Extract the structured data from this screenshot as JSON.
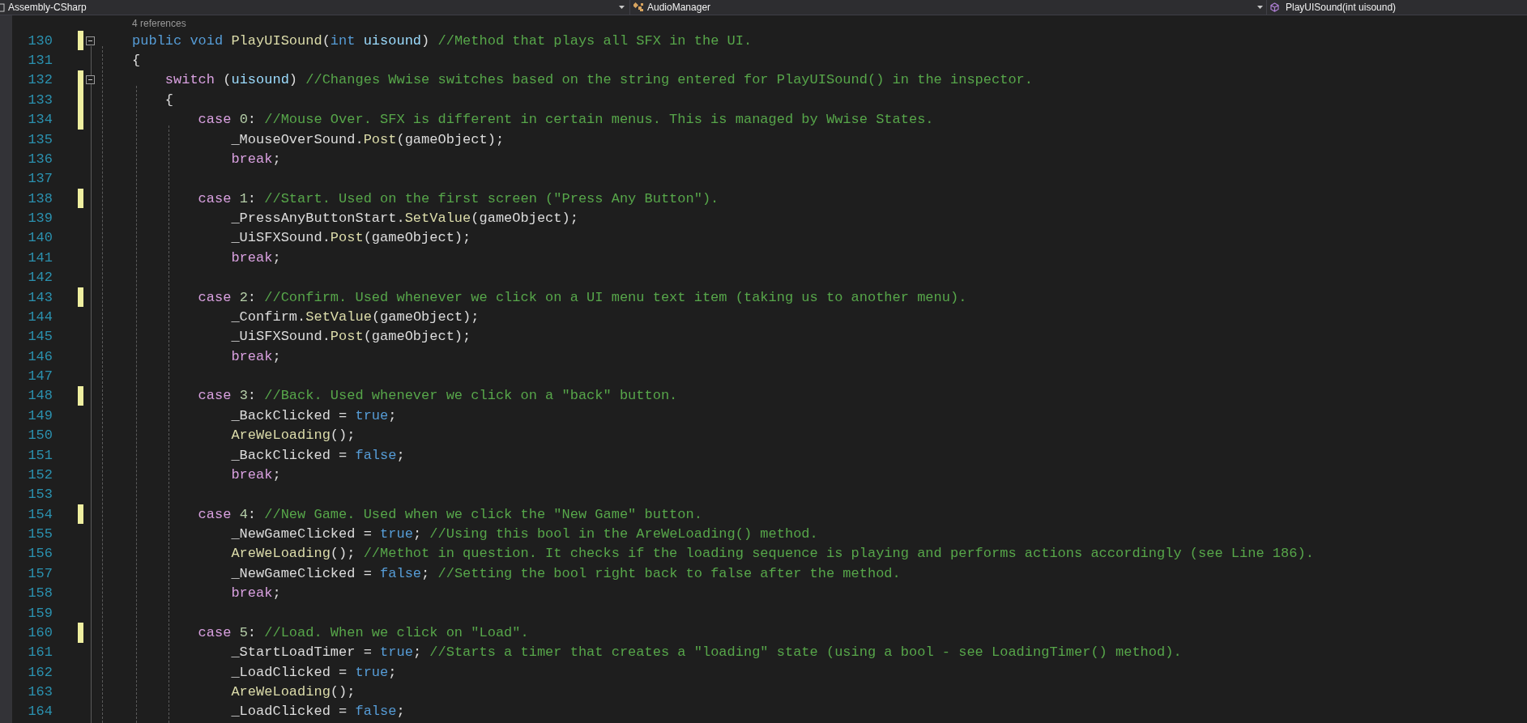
{
  "nav_bar": {
    "project": "Assembly-CSharp",
    "class": "AudioManager",
    "member": "PlayUISound(int uisound)"
  },
  "code_lens": "4 references",
  "lines": [
    {
      "number": "130",
      "modified": true,
      "expanded": true,
      "tokens": [
        {
          "kind": "keyword",
          "text": "public void "
        },
        {
          "kind": "method",
          "text": "PlayUISound"
        },
        {
          "kind": "plain",
          "text": "("
        },
        {
          "kind": "keyword",
          "text": "int "
        },
        {
          "kind": "param",
          "text": "uisound"
        },
        {
          "kind": "plain",
          "text": ") "
        },
        {
          "kind": "comment",
          "text": "//Method that plays all SFX in the UI."
        }
      ]
    },
    {
      "number": "131",
      "modified": false,
      "tokens": [
        {
          "kind": "plain",
          "text": "{"
        }
      ]
    },
    {
      "number": "132",
      "modified": true,
      "expanded": true,
      "tokens": [
        {
          "kind": "control",
          "text": "    switch"
        },
        {
          "kind": "plain",
          "text": " ("
        },
        {
          "kind": "param",
          "text": "uisound"
        },
        {
          "kind": "plain",
          "text": ") "
        },
        {
          "kind": "comment",
          "text": "//Changes Wwise switches based on the string entered for PlayUISound() in the inspector."
        }
      ]
    },
    {
      "number": "133",
      "modified": true,
      "tokens": [
        {
          "kind": "plain",
          "text": "    {"
        }
      ]
    },
    {
      "number": "134",
      "modified": true,
      "tokens": [
        {
          "kind": "control",
          "text": "        case "
        },
        {
          "kind": "number",
          "text": "0"
        },
        {
          "kind": "plain",
          "text": ": "
        },
        {
          "kind": "comment",
          "text": "//Mouse Over. SFX is different in certain menus. This is managed by Wwise States."
        }
      ]
    },
    {
      "number": "135",
      "modified": false,
      "tokens": [
        {
          "kind": "plain",
          "text": "            _MouseOverSound."
        },
        {
          "kind": "method",
          "text": "Post"
        },
        {
          "kind": "plain",
          "text": "(gameObject);"
        }
      ]
    },
    {
      "number": "136",
      "modified": false,
      "tokens": [
        {
          "kind": "control",
          "text": "            break"
        },
        {
          "kind": "plain",
          "text": ";"
        }
      ]
    },
    {
      "number": "137",
      "modified": false
    },
    {
      "number": "138",
      "modified": true,
      "tokens": [
        {
          "kind": "control",
          "text": "        case "
        },
        {
          "kind": "number",
          "text": "1"
        },
        {
          "kind": "plain",
          "text": ": "
        },
        {
          "kind": "comment",
          "text": "//Start. Used on the first screen (\"Press Any Button\")."
        }
      ]
    },
    {
      "number": "139",
      "modified": false,
      "tokens": [
        {
          "kind": "plain",
          "text": "            _PressAnyButtonStart."
        },
        {
          "kind": "method",
          "text": "SetValue"
        },
        {
          "kind": "plain",
          "text": "(gameObject);"
        }
      ]
    },
    {
      "number": "140",
      "modified": false,
      "tokens": [
        {
          "kind": "plain",
          "text": "            _UiSFXSound."
        },
        {
          "kind": "method",
          "text": "Post"
        },
        {
          "kind": "plain",
          "text": "(gameObject);"
        }
      ]
    },
    {
      "number": "141",
      "modified": false,
      "tokens": [
        {
          "kind": "control",
          "text": "            break"
        },
        {
          "kind": "plain",
          "text": ";"
        }
      ]
    },
    {
      "number": "142",
      "modified": false
    },
    {
      "number": "143",
      "modified": true,
      "tokens": [
        {
          "kind": "control",
          "text": "        case "
        },
        {
          "kind": "number",
          "text": "2"
        },
        {
          "kind": "plain",
          "text": ": "
        },
        {
          "kind": "comment",
          "text": "//Confirm. Used whenever we click on a UI menu text item (taking us to another menu)."
        }
      ]
    },
    {
      "number": "144",
      "modified": false,
      "tokens": [
        {
          "kind": "plain",
          "text": "            _Confirm."
        },
        {
          "kind": "method",
          "text": "SetValue"
        },
        {
          "kind": "plain",
          "text": "(gameObject);"
        }
      ]
    },
    {
      "number": "145",
      "modified": false,
      "tokens": [
        {
          "kind": "plain",
          "text": "            _UiSFXSound."
        },
        {
          "kind": "method",
          "text": "Post"
        },
        {
          "kind": "plain",
          "text": "(gameObject);"
        }
      ]
    },
    {
      "number": "146",
      "modified": false,
      "tokens": [
        {
          "kind": "control",
          "text": "            break"
        },
        {
          "kind": "plain",
          "text": ";"
        }
      ]
    },
    {
      "number": "147",
      "modified": false
    },
    {
      "number": "148",
      "modified": true,
      "tokens": [
        {
          "kind": "control",
          "text": "        case "
        },
        {
          "kind": "number",
          "text": "3"
        },
        {
          "kind": "plain",
          "text": ": "
        },
        {
          "kind": "comment",
          "text": "//Back. Used whenever we click on a \"back\" button."
        }
      ]
    },
    {
      "number": "149",
      "modified": false,
      "tokens": [
        {
          "kind": "plain",
          "text": "            _BackClicked = "
        },
        {
          "kind": "keyword",
          "text": "true"
        },
        {
          "kind": "plain",
          "text": ";"
        }
      ]
    },
    {
      "number": "150",
      "modified": false,
      "tokens": [
        {
          "kind": "method",
          "text": "            AreWeLoading"
        },
        {
          "kind": "plain",
          "text": "();"
        }
      ]
    },
    {
      "number": "151",
      "modified": false,
      "tokens": [
        {
          "kind": "plain",
          "text": "            _BackClicked = "
        },
        {
          "kind": "keyword",
          "text": "false"
        },
        {
          "kind": "plain",
          "text": ";"
        }
      ]
    },
    {
      "number": "152",
      "modified": false,
      "tokens": [
        {
          "kind": "control",
          "text": "            break"
        },
        {
          "kind": "plain",
          "text": ";"
        }
      ]
    },
    {
      "number": "153",
      "modified": false
    },
    {
      "number": "154",
      "modified": true,
      "tokens": [
        {
          "kind": "control",
          "text": "        case "
        },
        {
          "kind": "number",
          "text": "4"
        },
        {
          "kind": "plain",
          "text": ": "
        },
        {
          "kind": "comment",
          "text": "//New Game. Used when we click the \"New Game\" button."
        }
      ]
    },
    {
      "number": "155",
      "modified": false,
      "tokens": [
        {
          "kind": "plain",
          "text": "            _NewGameClicked = "
        },
        {
          "kind": "keyword",
          "text": "true"
        },
        {
          "kind": "plain",
          "text": "; "
        },
        {
          "kind": "comment",
          "text": "//Using this bool in the AreWeLoading() method."
        }
      ]
    },
    {
      "number": "156",
      "modified": false,
      "tokens": [
        {
          "kind": "method",
          "text": "            AreWeLoading"
        },
        {
          "kind": "plain",
          "text": "(); "
        },
        {
          "kind": "comment",
          "text": "//Methot in question. It checks if the loading sequence is playing and performs actions accordingly (see Line 186)."
        }
      ]
    },
    {
      "number": "157",
      "modified": false,
      "tokens": [
        {
          "kind": "plain",
          "text": "            _NewGameClicked = "
        },
        {
          "kind": "keyword",
          "text": "false"
        },
        {
          "kind": "plain",
          "text": "; "
        },
        {
          "kind": "comment",
          "text": "//Setting the bool right back to false after the method."
        }
      ]
    },
    {
      "number": "158",
      "modified": false,
      "tokens": [
        {
          "kind": "control",
          "text": "            break"
        },
        {
          "kind": "plain",
          "text": ";"
        }
      ]
    },
    {
      "number": "159",
      "modified": false
    },
    {
      "number": "160",
      "modified": true,
      "tokens": [
        {
          "kind": "control",
          "text": "        case "
        },
        {
          "kind": "number",
          "text": "5"
        },
        {
          "kind": "plain",
          "text": ": "
        },
        {
          "kind": "comment",
          "text": "//Load. When we click on \"Load\"."
        }
      ]
    },
    {
      "number": "161",
      "modified": false,
      "tokens": [
        {
          "kind": "plain",
          "text": "            _StartLoadTimer = "
        },
        {
          "kind": "keyword",
          "text": "true"
        },
        {
          "kind": "plain",
          "text": "; "
        },
        {
          "kind": "comment",
          "text": "//Starts a timer that creates a \"loading\" state (using a bool - see LoadingTimer() method)."
        }
      ]
    },
    {
      "number": "162",
      "modified": false,
      "tokens": [
        {
          "kind": "plain",
          "text": "            _LoadClicked = "
        },
        {
          "kind": "keyword",
          "text": "true"
        },
        {
          "kind": "plain",
          "text": ";"
        }
      ]
    },
    {
      "number": "163",
      "modified": false,
      "tokens": [
        {
          "kind": "method",
          "text": "            AreWeLoading"
        },
        {
          "kind": "plain",
          "text": "();"
        }
      ]
    },
    {
      "number": "164",
      "modified": false,
      "tokens": [
        {
          "kind": "plain",
          "text": "            _LoadClicked = "
        },
        {
          "kind": "keyword",
          "text": "false"
        },
        {
          "kind": "plain",
          "text": ";"
        }
      ]
    }
  ]
}
